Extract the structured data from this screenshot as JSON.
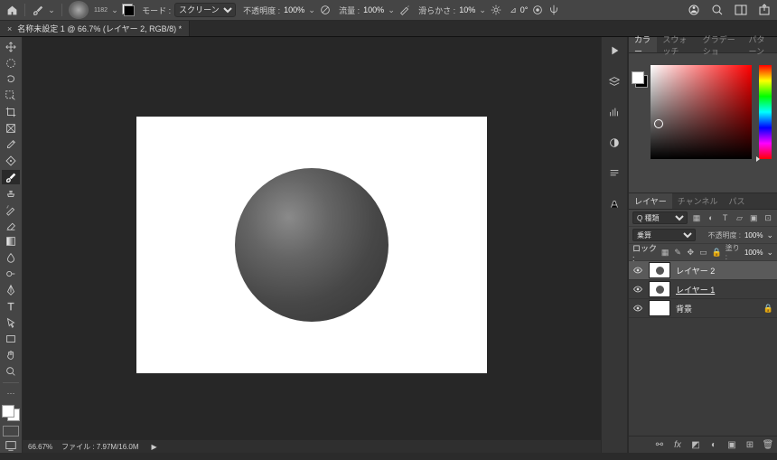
{
  "optionsBar": {
    "brushSize": "1182",
    "modeLabel": "モード :",
    "modeValue": "スクリーン",
    "opacityLabel": "不透明度 :",
    "opacityValue": "100%",
    "flowLabel": "流量 :",
    "flowValue": "100%",
    "smoothingLabel": "滑らかさ :",
    "smoothingValue": "10%",
    "angleLabel": "⊿",
    "angleValue": "0°"
  },
  "docTab": {
    "title": "名称未設定 1 @ 66.7% (レイヤー 2, RGB/8) *"
  },
  "statusBar": {
    "zoom": "66.67%",
    "fileLabel": "ファイル :",
    "fileValue": "7.97M/16.0M"
  },
  "colorPanel": {
    "tabs": [
      "カラー",
      "スウォッチ",
      "グラデーショ",
      "パターン"
    ],
    "activeTab": 0
  },
  "layersPanel": {
    "tabs": [
      "レイヤー",
      "チャンネル",
      "パス"
    ],
    "activeTab": 0,
    "searchPlaceholder": "Q 種類",
    "blendMode": "乗算",
    "opacityLabel": "不透明度 :",
    "opacityValue": "100%",
    "lockLabel": "ロック :",
    "fillLabel": "塗り :",
    "fillValue": "100%",
    "layers": [
      {
        "name": "レイヤー 2",
        "visible": true,
        "selected": true,
        "thumb": "sphere",
        "locked": false
      },
      {
        "name": "レイヤー 1",
        "visible": true,
        "selected": false,
        "thumb": "sphere",
        "locked": false,
        "underline": true
      },
      {
        "name": "背景",
        "visible": true,
        "selected": false,
        "thumb": "white",
        "locked": true
      }
    ]
  },
  "footerIcons": [
    "link",
    "fx",
    "mask",
    "adjust",
    "group",
    "new",
    "trash"
  ]
}
